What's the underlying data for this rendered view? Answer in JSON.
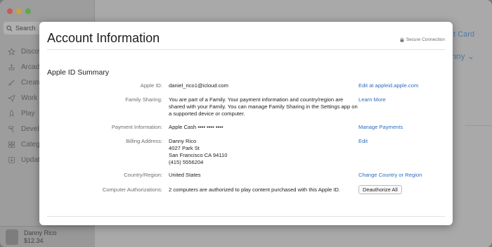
{
  "sidebar": {
    "search_placeholder": "Search",
    "items": [
      {
        "label": "Discover",
        "icon": "star-icon"
      },
      {
        "label": "Arcade",
        "icon": "joystick-icon"
      },
      {
        "label": "Create",
        "icon": "brush-icon"
      },
      {
        "label": "Work",
        "icon": "paperplane-icon"
      },
      {
        "label": "Play",
        "icon": "rocket-icon"
      },
      {
        "label": "Develop",
        "icon": "hammer-icon"
      },
      {
        "label": "Categories",
        "icon": "grid-icon"
      },
      {
        "label": "Updates",
        "icon": "download-icon"
      }
    ],
    "user": {
      "name": "Danny Rico",
      "balance": "$12.34"
    }
  },
  "background": {
    "right_link_1": "t Card",
    "right_link_2": "anny ⌄"
  },
  "modal": {
    "title": "Account Information",
    "secure_label": "Secure Connection",
    "section_title": "Apple ID Summary",
    "rows": {
      "apple_id": {
        "label": "Apple ID:",
        "value": "daniel_rico1@icloud.com",
        "action": "Edit at appleid.apple.com"
      },
      "family": {
        "label": "Family Sharing:",
        "value": "You are part of a Family. Your payment information and country/region are shared with your Family. You can manage Family Sharing in the Settings app on a supported device or computer.",
        "action": "Learn More"
      },
      "payment": {
        "label": "Payment Information:",
        "value": "Apple Cash •••• •••• ••••",
        "action": "Manage Payments"
      },
      "billing": {
        "label": "Billing Address:",
        "lines": [
          "Danny Rico",
          "4027 Park St",
          "San Francisco CA 94110",
          "(415) 5556204"
        ],
        "action": "Edit"
      },
      "country": {
        "label": "Country/Region:",
        "value": "United States",
        "action": "Change Country or Region"
      },
      "auth": {
        "label": "Computer Authorizations:",
        "value": "2 computers are authorized to play content purchased with this Apple ID.",
        "button": "Deauthorize All"
      }
    }
  }
}
